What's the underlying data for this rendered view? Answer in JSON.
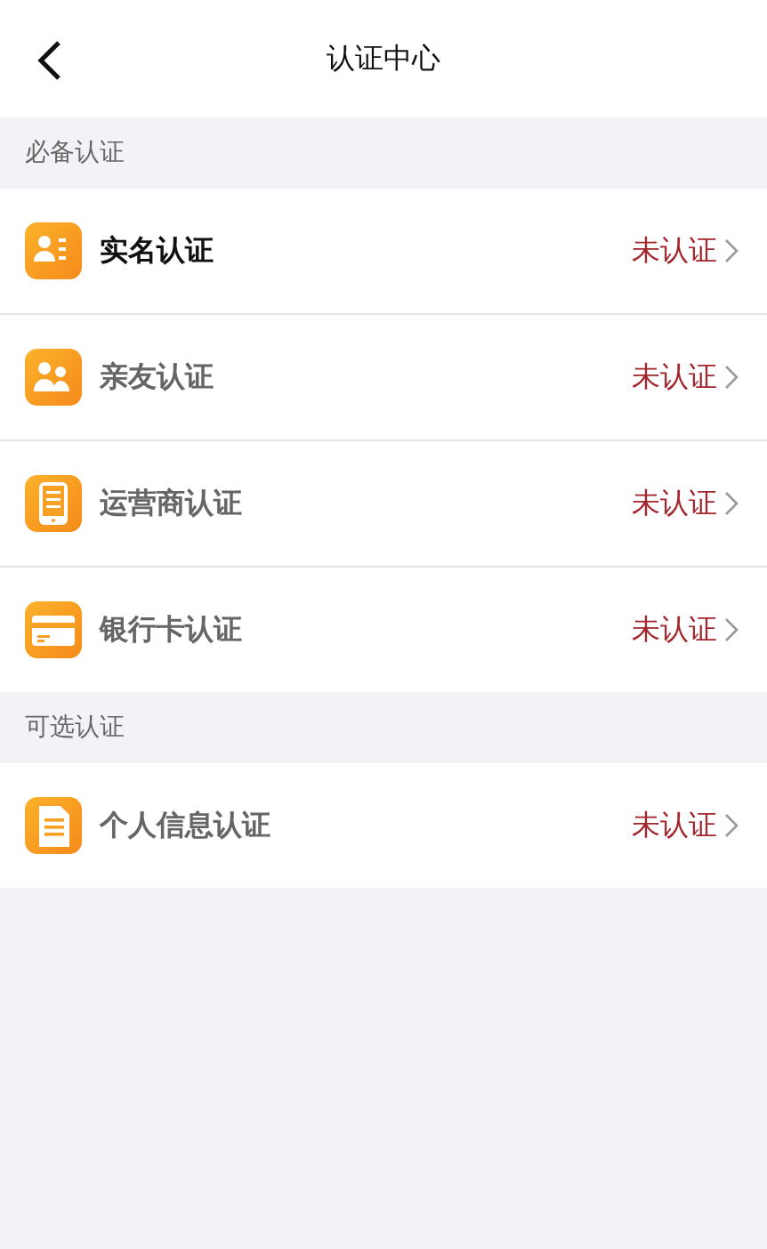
{
  "header": {
    "title": "认证中心"
  },
  "sections": [
    {
      "title": "必备认证",
      "items": [
        {
          "kind": "id-card",
          "label": "实名认证",
          "status": "未认证",
          "highlighted": true
        },
        {
          "kind": "people",
          "label": "亲友认证",
          "status": "未认证",
          "highlighted": false
        },
        {
          "kind": "phone",
          "label": "运营商认证",
          "status": "未认证",
          "highlighted": false
        },
        {
          "kind": "bank-card",
          "label": "银行卡认证",
          "status": "未认证",
          "highlighted": false
        }
      ]
    },
    {
      "title": "可选认证",
      "items": [
        {
          "kind": "document",
          "label": "个人信息认证",
          "status": "未认证",
          "highlighted": false
        }
      ]
    }
  ]
}
